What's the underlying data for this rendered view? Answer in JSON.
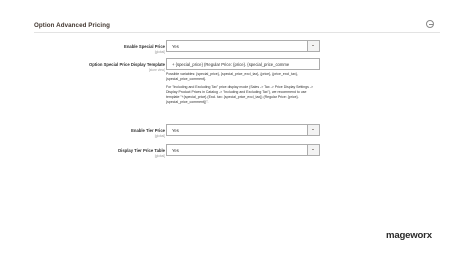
{
  "section": {
    "title": "Option Advanced Pricing"
  },
  "fields": {
    "enable_special_price": {
      "label": "Enable Special Price",
      "scope": "[global]",
      "value": "Yes"
    },
    "special_price_template": {
      "label": "Option Special Price Display Template",
      "scope": "[store view]",
      "value": "+ {special_price} (Regular Price: {price}. {special_price_comme",
      "note_1": "Possible variables: {special_price}, {special_price_excl_tax}, {price}, {price_excl_tax}, {special_price_comment}.",
      "note_2": "For \"Including and Excluding Tax\" price display mode (Sales -> Tax -> Price Display Settings -> Display Product Prices in Catalog -> \"Including and Excluding Tax\"), we recommend to use template \"+{special_price} (Excl. tax: {special_price_excl_tax}) (Regular Price: {price}. {special_price_comment})\"."
    },
    "enable_tier_price": {
      "label": "Enable Tier Price",
      "scope": "[global]",
      "value": "Yes"
    },
    "display_tier_price_table": {
      "label": "Display Tier Price Table",
      "scope": "[global]",
      "value": "Yes"
    }
  },
  "brand": {
    "logo_text": "mageworx"
  }
}
